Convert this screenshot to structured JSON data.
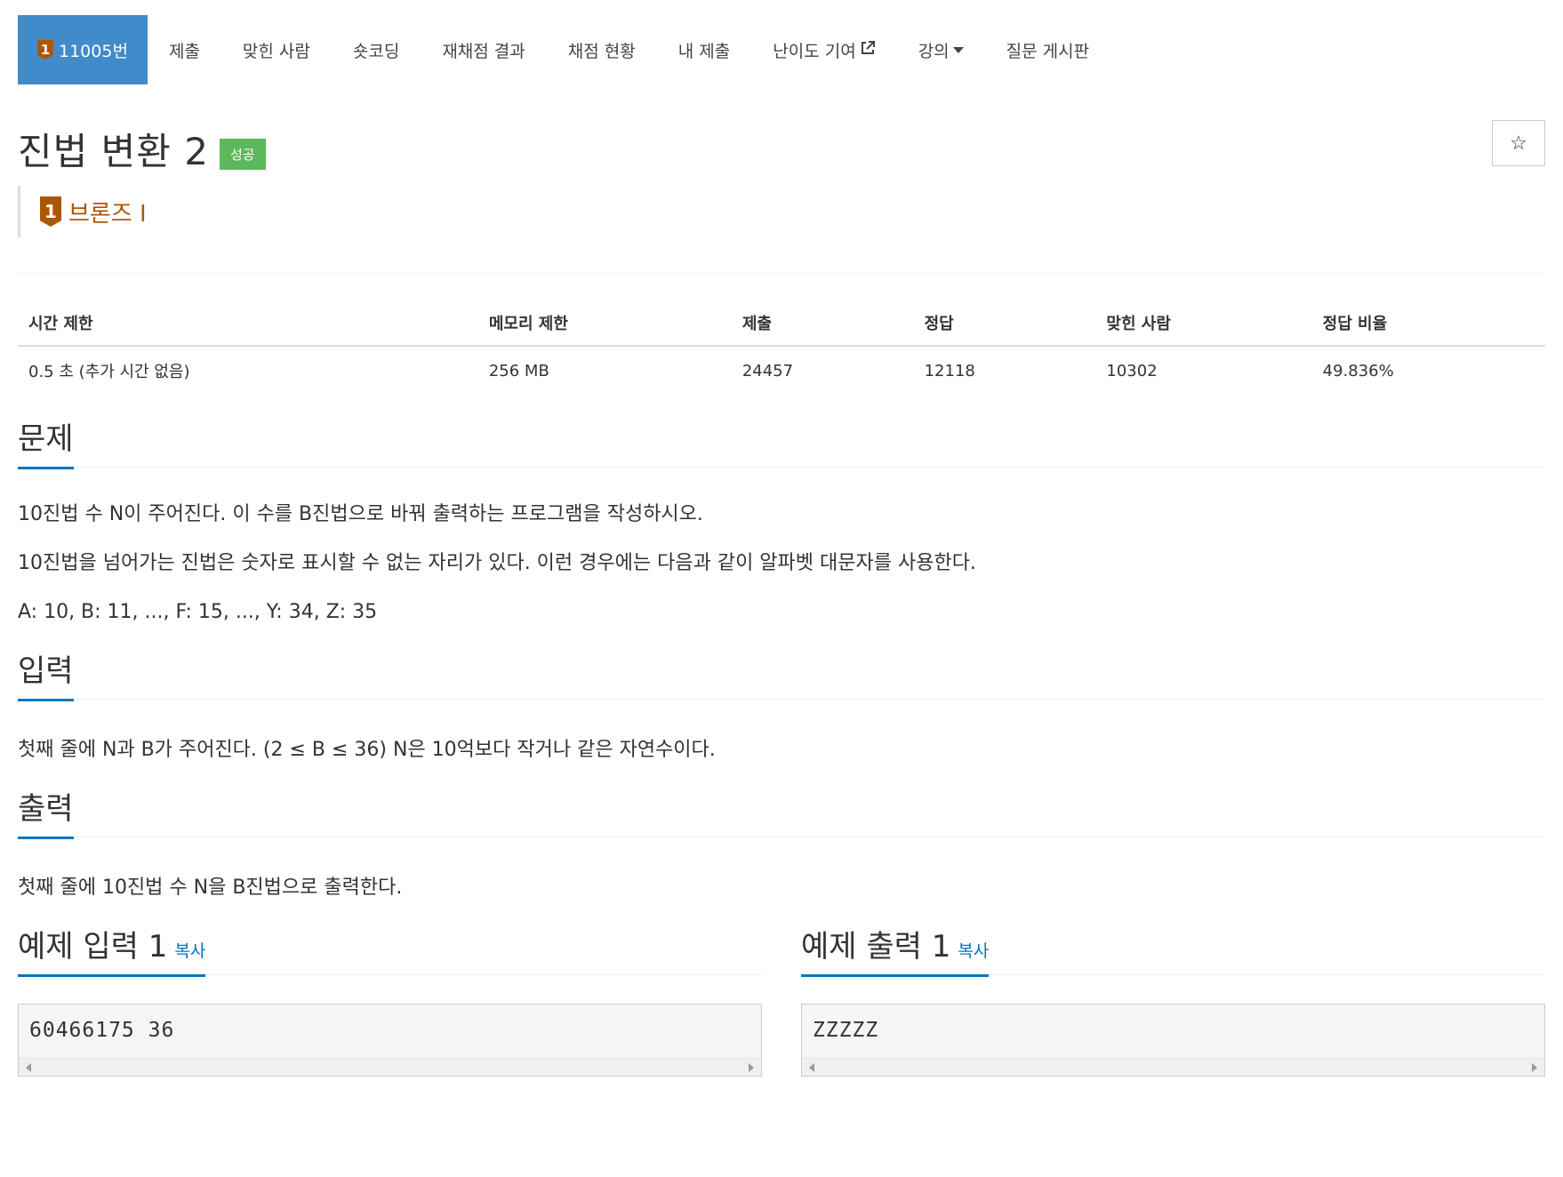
{
  "nav": {
    "problem_tier": "1",
    "problem_id": "11005번",
    "items": [
      "제출",
      "맞힌 사람",
      "숏코딩",
      "재채점 결과",
      "채점 현황",
      "내 제출",
      "난이도 기여",
      "강의",
      "질문 게시판"
    ]
  },
  "title": "진법 변환 2",
  "status_badge": "성공",
  "star_icon": "☆",
  "tier": {
    "num": "1",
    "label": "브론즈 I",
    "color": "#ad5600"
  },
  "info": {
    "headers": [
      "시간 제한",
      "메모리 제한",
      "제출",
      "정답",
      "맞힌 사람",
      "정답 비율"
    ],
    "values": [
      "0.5 초 (추가 시간 없음)",
      "256 MB",
      "24457",
      "12118",
      "10302",
      "49.836%"
    ]
  },
  "problem": {
    "heading": "문제",
    "paragraphs": [
      "10진법 수 N이 주어진다. 이 수를 B진법으로 바꿔 출력하는 프로그램을 작성하시오.",
      "10진법을 넘어가는 진법은 숫자로 표시할 수 없는 자리가 있다. 이런 경우에는 다음과 같이 알파벳 대문자를 사용한다.",
      "A: 10, B: 11, ..., F: 15, ..., Y: 34, Z: 35"
    ]
  },
  "input": {
    "heading": "입력",
    "text": "첫째 줄에 N과 B가 주어진다. (2 ≤ B ≤ 36) N은 10억보다 작거나 같은 자연수이다."
  },
  "output": {
    "heading": "출력",
    "text": "첫째 줄에 10진법 수 N을 B진법으로 출력한다."
  },
  "sample_input": {
    "heading": "예제 입력 1",
    "copy": "복사",
    "content": "60466175 36"
  },
  "sample_output": {
    "heading": "예제 출력 1",
    "copy": "복사",
    "content": "ZZZZZ"
  },
  "colors": {
    "accent": "#428bca",
    "link": "#0076c0",
    "success": "#5cb85c",
    "bronze": "#ad5600"
  }
}
